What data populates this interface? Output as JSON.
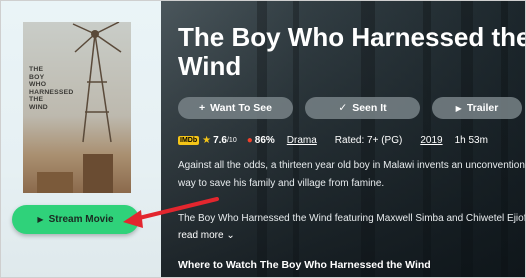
{
  "movie": {
    "title": "The Boy Who Harnessed the\nWind",
    "poster_text": "THE\nBOY\nWHO\nHARNESSED\nTHE\nWIND"
  },
  "actions": {
    "want_to_see": "Want To See",
    "seen_it": "Seen It",
    "trailer": "Trailer",
    "stream": "Stream Movie"
  },
  "meta": {
    "imdb_badge": "IMDb",
    "imdb_score": "7.6",
    "imdb_scale": "/10",
    "rt_score": "86%",
    "genre": "Drama",
    "rating": "Rated: 7+ (PG)",
    "year": "2019",
    "runtime": "1h 53m"
  },
  "description": {
    "synopsis": "Against all the odds, a thirteen year old boy in Malawi invents an unconventional way to save his family and village from famine.",
    "cast_line": "The Boy Who Harnessed the Wind featuring Maxwell Simba and Chiwetel Ejiofor",
    "read_more": "read more"
  },
  "section": {
    "where_to_watch": "Where to Watch The Boy Who Harnessed the Wind"
  },
  "colors": {
    "stream_green": "#2fd27a",
    "arrow_red": "#e3262e",
    "imdb_yellow": "#f5c518"
  }
}
